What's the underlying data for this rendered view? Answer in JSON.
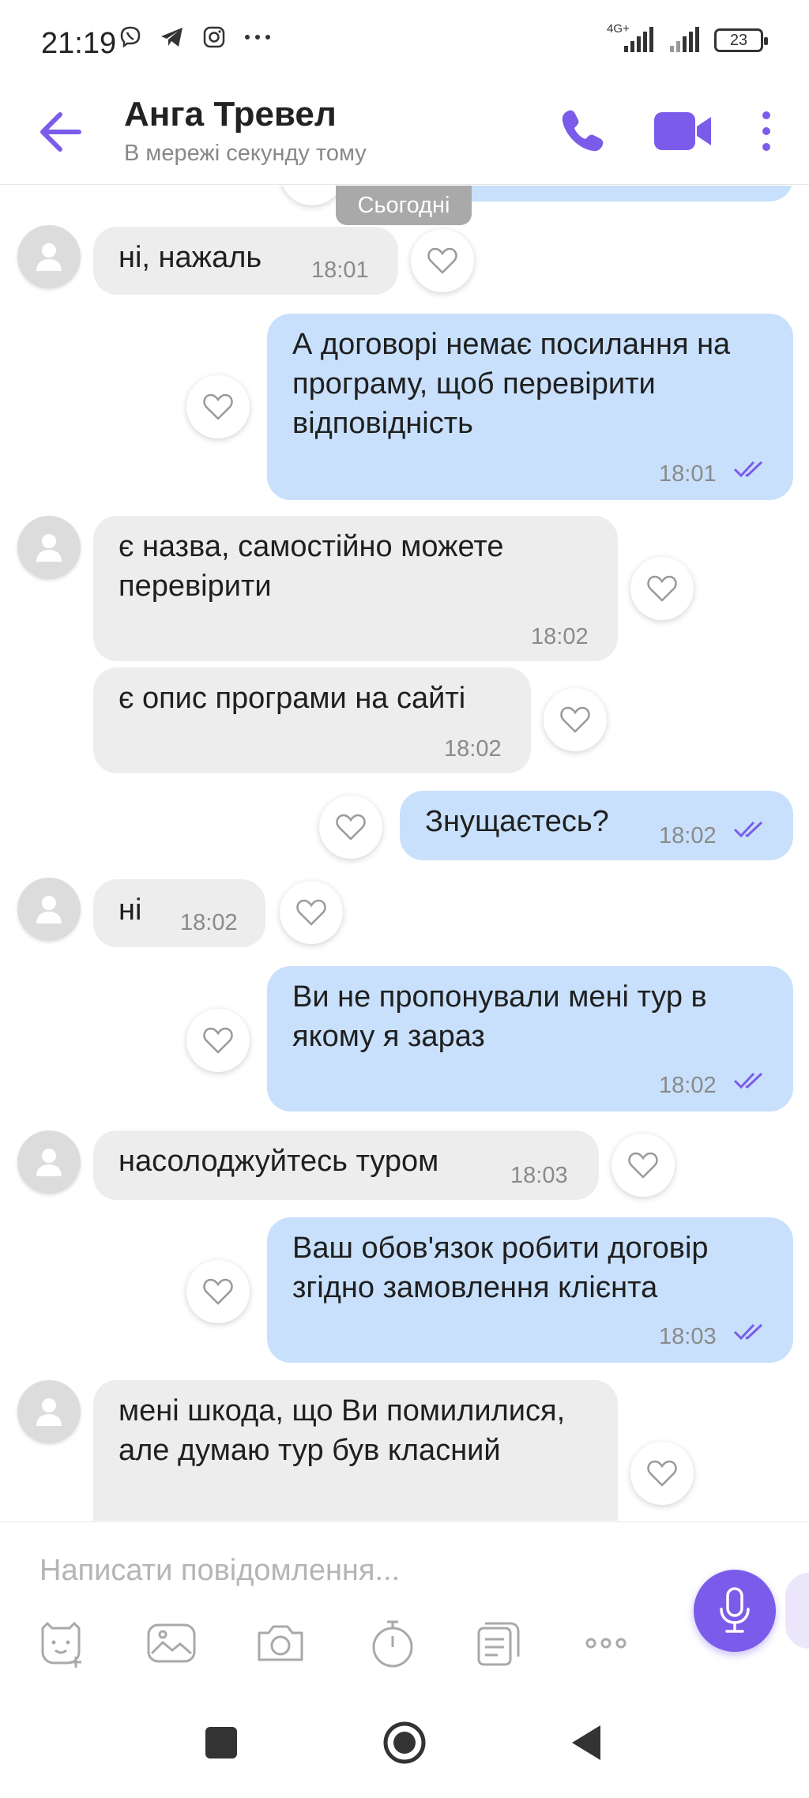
{
  "status_bar": {
    "time": "21:19",
    "network": "4G+",
    "battery": "23",
    "icons": [
      "viber-icon",
      "telegram-icon",
      "instagram-icon",
      "more-dots-icon",
      "signal-icon",
      "signal-icon",
      "battery-icon"
    ]
  },
  "header": {
    "title": "Анга Тревел",
    "subtitle": "В мережі секунду тому",
    "accent_color": "#7b5cea"
  },
  "date_chip": "Сьогодні",
  "messages": [
    {
      "dir": "in",
      "text": "ні, нажаль",
      "time": "18:01"
    },
    {
      "dir": "out",
      "text": "А договорі немає посилання на програму, щоб перевірити відповідність",
      "time": "18:01"
    },
    {
      "dir": "in",
      "text": "є назва, самостійно можете перевірити",
      "time": "18:02"
    },
    {
      "dir": "in",
      "text": "є опис програми на сайті",
      "time": "18:02"
    },
    {
      "dir": "out",
      "text": "Знущаєтесь?",
      "time": "18:02"
    },
    {
      "dir": "in",
      "text": "ні",
      "time": "18:02"
    },
    {
      "dir": "out",
      "text": "Ви не пропонували мені тур в якому я зараз",
      "time": "18:02"
    },
    {
      "dir": "in",
      "text": "насолоджуйтесь туром",
      "time": "18:03"
    },
    {
      "dir": "out",
      "text": "Ваш обов'язок робити договір згідно замовлення клієнта",
      "time": "18:03"
    },
    {
      "dir": "in",
      "text": "мені шкода, що Ви помилилися, але думаю тур був класний",
      "time": ""
    }
  ],
  "composer": {
    "placeholder": "Написати повідомлення...",
    "tools": [
      "sticker-icon",
      "gallery-icon",
      "camera-icon",
      "timer-icon",
      "gif-icon",
      "more-icon"
    ]
  },
  "colors": {
    "incoming_bubble": "#ededed",
    "outgoing_bubble": "#c8e0fb",
    "accent": "#7b5cea"
  }
}
